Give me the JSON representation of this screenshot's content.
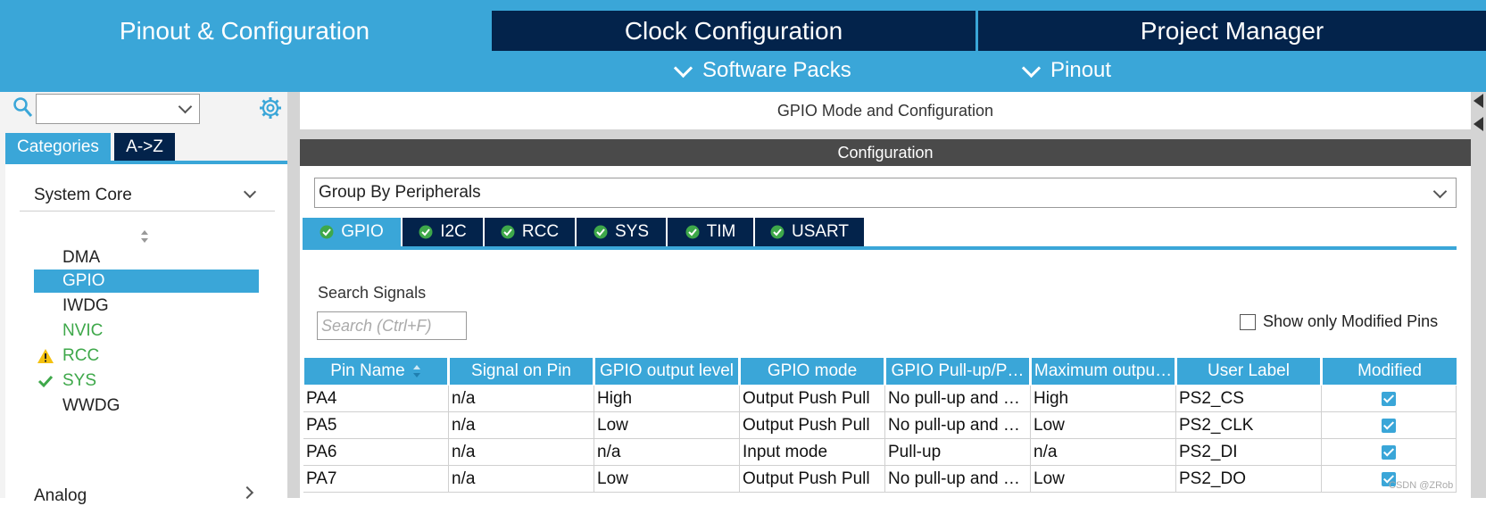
{
  "top_nav": {
    "tabs": [
      {
        "label": "Pinout & Configuration",
        "active": true
      },
      {
        "label": "Clock Configuration",
        "active": false
      },
      {
        "label": "Project Manager",
        "active": false
      }
    ],
    "sub_menus": [
      "Software Packs",
      "Pinout"
    ]
  },
  "left_panel": {
    "search_value": "",
    "tabs": [
      "Categories",
      "A->Z"
    ],
    "section_title": "System Core",
    "items": [
      {
        "label": "DMA",
        "status": "none",
        "color": "#222222"
      },
      {
        "label": "GPIO",
        "status": "selected",
        "color": "#ffffff"
      },
      {
        "label": "IWDG",
        "status": "none",
        "color": "#222222"
      },
      {
        "label": "NVIC",
        "status": "configured",
        "color": "#3ea84a"
      },
      {
        "label": "RCC",
        "status": "warning",
        "color": "#3ea84a"
      },
      {
        "label": "SYS",
        "status": "ok",
        "color": "#3ea84a"
      },
      {
        "label": "WWDG",
        "status": "none",
        "color": "#222222"
      }
    ],
    "next_section": "Analog"
  },
  "main": {
    "title": "GPIO Mode and Configuration",
    "config_header": "Configuration",
    "group_by": "Group By Peripherals",
    "peripheral_tabs": [
      "GPIO",
      "I2C",
      "RCC",
      "SYS",
      "TIM",
      "USART"
    ],
    "search_label": "Search Signals",
    "search_placeholder": "Search (Ctrl+F)",
    "show_modified_label": "Show only Modified Pins",
    "table": {
      "columns": [
        "Pin Name",
        "Signal on Pin",
        "GPIO output level",
        "GPIO mode",
        "GPIO Pull-up/P…",
        "Maximum outpu…",
        "User Label",
        "Modified"
      ],
      "rows": [
        [
          "PA4",
          "n/a",
          "High",
          "Output Push Pull",
          "No pull-up and …",
          "High",
          "PS2_CS"
        ],
        [
          "PA5",
          "n/a",
          "Low",
          "Output Push Pull",
          "No pull-up and …",
          "Low",
          "PS2_CLK"
        ],
        [
          "PA6",
          "n/a",
          "n/a",
          "Input mode",
          "Pull-up",
          "n/a",
          "PS2_DI"
        ],
        [
          "PA7",
          "n/a",
          "Low",
          "Output Push Pull",
          "No pull-up and …",
          "Low",
          "PS2_DO"
        ]
      ],
      "modified": [
        true,
        true,
        true,
        true
      ]
    }
  },
  "watermark": "CSDN @ZRob",
  "colors": {
    "accent": "#3aa6d8",
    "navy": "#03234b",
    "green": "#3ea84a",
    "dark_header": "#4a4a4a"
  }
}
